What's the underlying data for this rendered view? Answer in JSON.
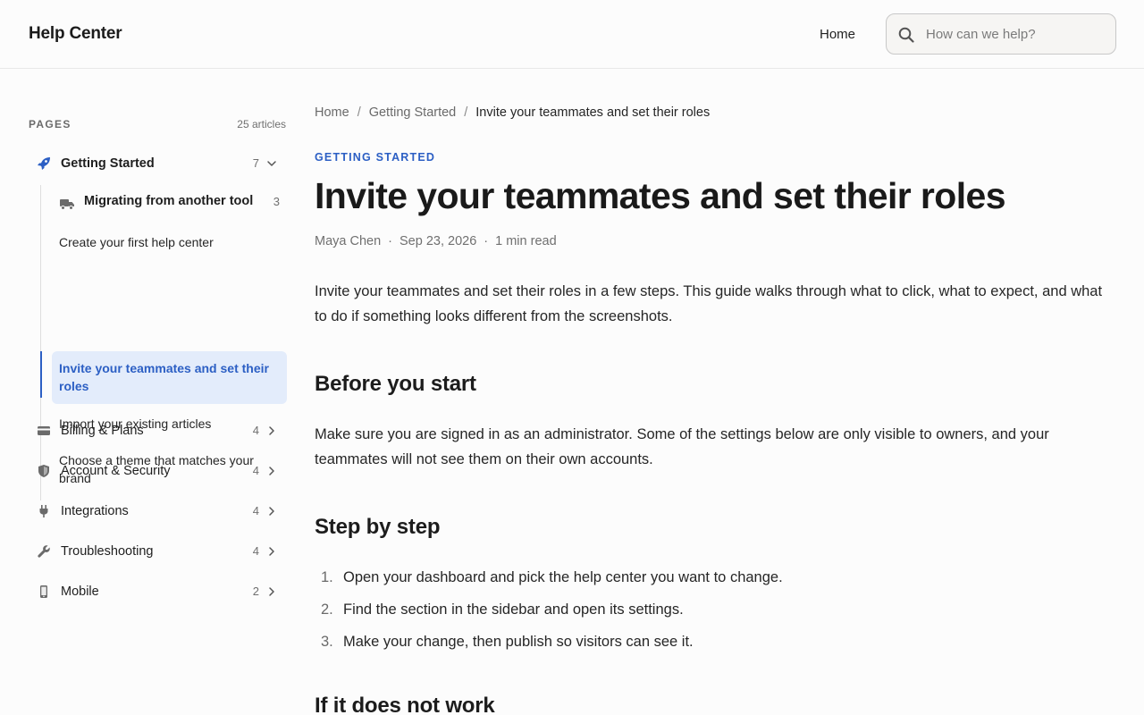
{
  "header": {
    "brand": "Help Center",
    "nav_home": "Home",
    "search_placeholder": "How can we help?"
  },
  "sidebar": {
    "title": "PAGES",
    "count": "25 articles",
    "categories": [
      {
        "label": "Getting Started",
        "count": "7",
        "icon": "rocket-icon",
        "expanded": true
      },
      {
        "label": "Billing & Plans",
        "count": "4",
        "icon": "credit-card-icon"
      },
      {
        "label": "Account & Security",
        "count": "4",
        "icon": "shield-icon"
      },
      {
        "label": "Integrations",
        "count": "4",
        "icon": "plug-icon"
      },
      {
        "label": "Troubleshooting",
        "count": "4",
        "icon": "wrench-icon"
      },
      {
        "label": "Mobile",
        "count": "2",
        "icon": "phone-icon"
      }
    ],
    "subgroup": {
      "label": "Migrating from another tool",
      "count": "3",
      "icon": "truck-icon"
    },
    "articles": [
      "Create your first help center",
      "Invite your teammates and set their roles",
      "Import your existing articles",
      "Choose a theme that matches your brand"
    ]
  },
  "breadcrumb": [
    "Home",
    "Getting Started",
    "Invite your teammates and set their roles"
  ],
  "article": {
    "kicker": "GETTING STARTED",
    "title": "Invite your teammates and set their roles",
    "author": "Maya Chen",
    "date": "Sep 23, 2026",
    "read_time": "1 min read",
    "intro": "Invite your teammates and set their roles in a few steps. This guide walks through what to click, what to expect, and what to do if something looks different from the screenshots.",
    "sections": [
      {
        "heading": "Before you start",
        "body": "Make sure you are signed in as an administrator. Some of the settings below are only visible to owners, and your teammates will not see them on their own accounts."
      },
      {
        "heading": "Step by step",
        "steps": [
          "Open your dashboard and pick the help center you want to change.",
          "Find the section in the sidebar and open its settings.",
          "Make your change, then publish so visitors can see it."
        ]
      },
      {
        "heading": "If it does not work"
      }
    ]
  },
  "colors": {
    "accent": "#2c5fc4",
    "active_bg": "#e3ecfb"
  }
}
